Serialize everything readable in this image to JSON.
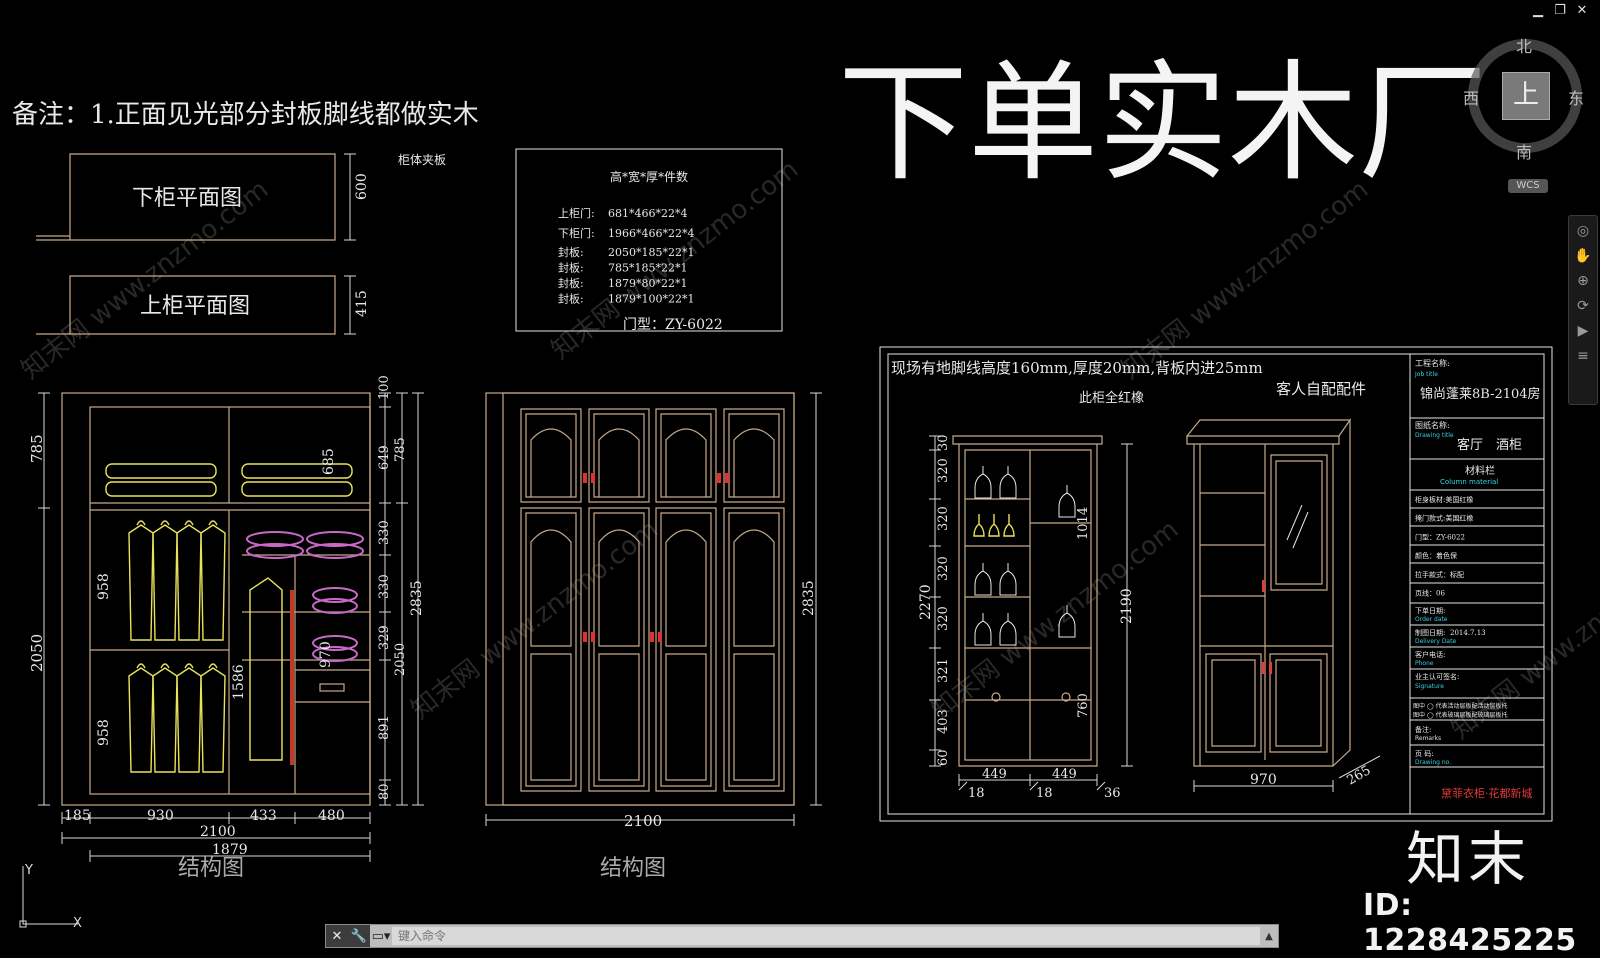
{
  "window": {
    "controls": [
      "minimize",
      "restore",
      "close"
    ]
  },
  "notes": {
    "remark": "备注：1.正面见光部分封板脚线都做实木"
  },
  "banner": {
    "text": "下单实木厂"
  },
  "viewcube": {
    "north": "北",
    "west": "西",
    "east": "东",
    "south": "南",
    "top": "上",
    "ucs": "WCS"
  },
  "plans": {
    "lower_title": "下柜平面图",
    "upper_title": "上柜平面图",
    "lower_dim": "600",
    "upper_dim": "415",
    "side_label": "柜体夹板"
  },
  "parts": {
    "header": "高*宽*厚*件数",
    "rows": [
      {
        "name": "上柜门:",
        "value": "681*466*22*4"
      },
      {
        "name": "下柜门:",
        "value": "1966*466*22*4"
      },
      {
        "name": "封板:",
        "value": "2050*185*22*1"
      },
      {
        "name": "封板:",
        "value": "785*185*22*1"
      },
      {
        "name": "封板:",
        "value": "1879*80*22*1"
      },
      {
        "name": "封板:",
        "value": "1879*100*22*1"
      }
    ],
    "door_type": "门型：ZY-6022"
  },
  "wardrobe_structure": {
    "caption": "结构图",
    "dims_left": [
      "785",
      "2050",
      "958",
      "958"
    ],
    "dims_inner": [
      "685",
      "1586",
      "970",
      "330",
      "330",
      "329"
    ],
    "dims_right_a": [
      "100",
      "649",
      "330",
      "330",
      "329",
      "891",
      "80"
    ],
    "dims_right_b": [
      "785",
      "2050"
    ],
    "dim_total_h": "2835",
    "dims_bottom": [
      "185",
      "930",
      "433",
      "480"
    ],
    "dim_width": "2100",
    "dim_inner_width": "1879"
  },
  "wardrobe_front": {
    "caption": "结构图",
    "dim_height": "2835",
    "dim_width": "2100"
  },
  "cabinet_sheet": {
    "note_top": "现场有地脚线高度160mm,厚度20mm,背板内进25mm",
    "note_wood": "此柜全红橡",
    "note_fittings": "客人自配配件",
    "left_dims": [
      "30",
      "320",
      "320",
      "320",
      "320",
      "321",
      "403",
      "60"
    ],
    "total_left": "2270",
    "inner_dims": [
      "1014",
      "760"
    ],
    "bottom_dims": [
      "449",
      "449"
    ],
    "small_dims": [
      "18",
      "18",
      "36"
    ],
    "side_height": "2190",
    "side_width": "970",
    "side_depth": "265",
    "title_block": {
      "job_title_cn": "工程名称:",
      "job_title_en": "Job title",
      "job_value": "锦尚蓬莱8B-2104房",
      "drawing_title_cn": "图纸名称:",
      "drawing_title_en": "Drawing title",
      "drawing_value": "客厅　酒柜",
      "material_cn": "材料栏",
      "material_en": "Column material",
      "rows": [
        "柜身板材:美国红橡",
        "掩门款式:美国红橡",
        "门型：ZY-6022",
        "颜色：着色保",
        "拉手款式：标配",
        "页线：06"
      ],
      "order_date_cn": "下单日期:",
      "order_date_en": "Order date",
      "delivery_cn": "制图日期:",
      "delivery_value": "2014.7.13",
      "delivery_en": "Delivery Date",
      "phone_cn": "客户电话:",
      "phone_en": "Phone",
      "sign_cn": "业主认可签名:",
      "sign_en": "Signature",
      "legend_1": "图中 ◯ 代表活动层板配活动层板托",
      "legend_2": "图中 ◯ 代表玻璃层板配玻璃层板托",
      "remarks_cn": "备注:",
      "remarks_en": "Remarks",
      "page_cn": "页 码:",
      "page_en": "Drawing no.",
      "brand": "黛菲衣柜·花都新城"
    }
  },
  "watermark": {
    "text": "知末网 www.znzmo.com",
    "logo": "知末",
    "id": "ID: 1228425225"
  },
  "command": {
    "placeholder": "键入命令"
  }
}
